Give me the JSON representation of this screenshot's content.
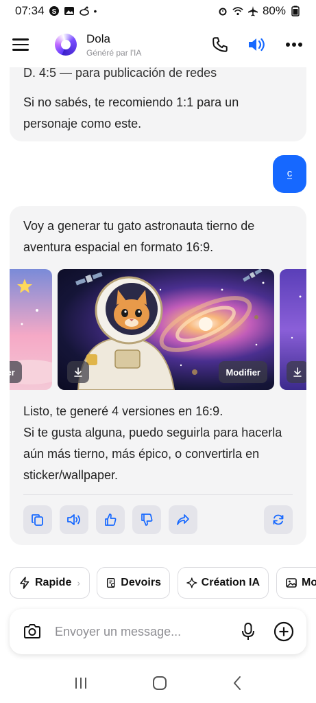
{
  "status_bar": {
    "time": "07:34",
    "battery": "80%"
  },
  "header": {
    "bot_name": "Dola",
    "bot_subtitle": "Généré par l'IA"
  },
  "chat": {
    "prev_message": {
      "cut_line": "D. 4:5 — para publicación de redes",
      "paragraph": "Si no sabés, te recomiendo 1:1 para un personaje como este."
    },
    "user_message": "c",
    "bot_message": {
      "intro": "Voy a generar tu gato astronauta tierno de aventura espacial en formato 16:9.",
      "gallery": {
        "modify_label": "Modifier",
        "modify_label_left": "odifier"
      },
      "outro_line1": "Listo, te generé 4 versiones en 16:9.",
      "outro_line2": "Si te gusta alguna, puedo seguirla para hacerla aún más tierno, más épico, o convertirla en sticker/wallpaper."
    }
  },
  "quick_actions": [
    {
      "label": "Rapide",
      "icon": "bolt-icon"
    },
    {
      "label": "Devoirs",
      "icon": "homework-icon"
    },
    {
      "label": "Création IA",
      "icon": "sparkle-icon"
    },
    {
      "label": "Mo",
      "icon": "image-icon"
    }
  ],
  "composer": {
    "placeholder": "Envoyer un message..."
  },
  "colors": {
    "accent": "#1668ff",
    "bubble_bg": "#f4f4f5"
  }
}
